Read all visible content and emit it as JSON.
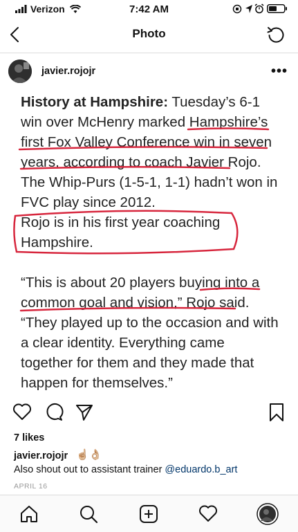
{
  "status_bar": {
    "carrier": "Verizon",
    "time": "7:42 AM"
  },
  "nav": {
    "title": "Photo"
  },
  "post": {
    "username": "javier.rojojr",
    "photo_text": {
      "line1_bold": "History at Hampshire:",
      "line1_rest": " Tuesday’s 6-1",
      "line2": "win over McHenry marked Hampshire’s",
      "line3": "first Fox Valley Conference win in seven",
      "line4": "years, according to coach Javier Rojo.",
      "line5": "The Whip-Purs (1-5-1, 1-1) hadn’t won in",
      "line6": "FVC play since 2012.",
      "line7": "Rojo is in his first year coaching",
      "line8": "Hampshire.",
      "line9": "“This is about 20 players buying into a",
      "line10": "common goal and vision,” Rojo said.",
      "line11": "“They played up to the occasion and with",
      "line12": "a clear identity. Everything came",
      "line13": "together for them and they made that",
      "line14": "happen for themselves.”"
    },
    "likes": "7 likes",
    "caption_user": "javier.rojojr",
    "caption_emoji": "☝🏼👌🏼",
    "caption_text": "Also shout out to assistant trainer ",
    "caption_mention": "@eduardo.b_art",
    "date": "APRIL 16"
  },
  "colors": {
    "underline": "#d7263d",
    "mention": "#003569"
  }
}
